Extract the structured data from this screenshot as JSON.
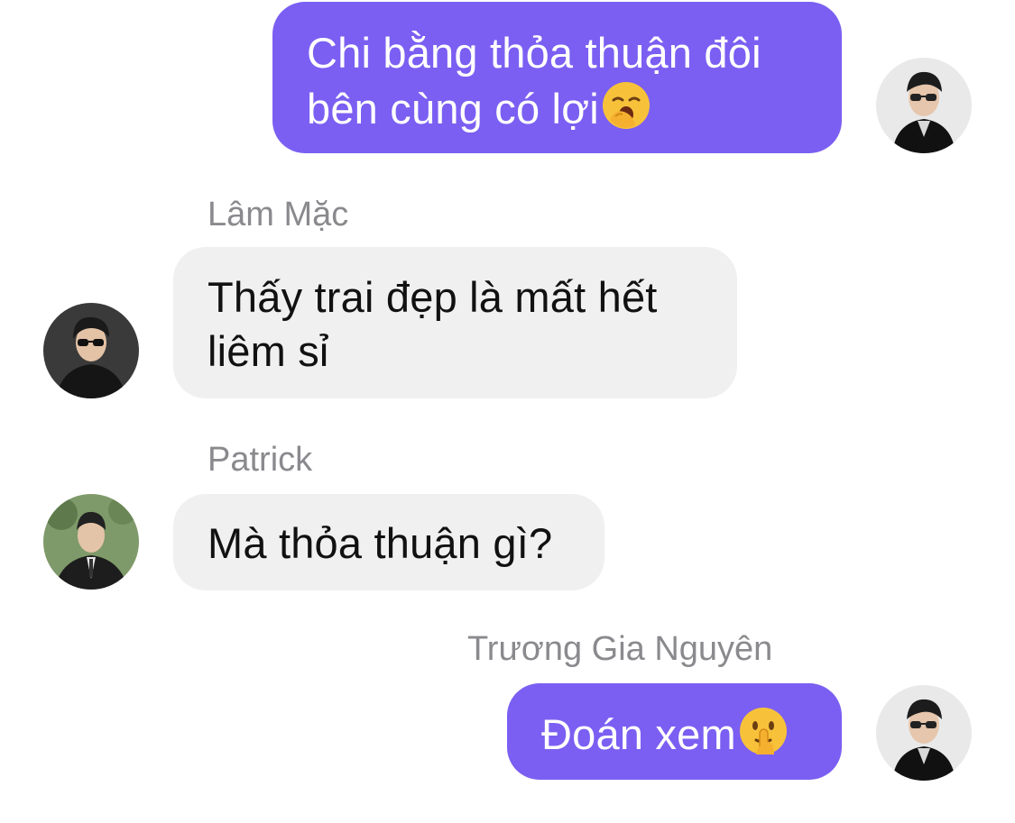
{
  "messages": [
    {
      "direction": "outgoing",
      "sender": "",
      "lines": [
        "Chi bằng thỏa thuận đôi",
        "bên cùng có lợi"
      ],
      "emoji": "yawning-face-icon"
    },
    {
      "direction": "incoming",
      "sender": "Lâm Mặc",
      "lines": [
        "Thấy trai đẹp là mất hết",
        "liêm sỉ"
      ],
      "emoji": ""
    },
    {
      "direction": "incoming",
      "sender": "Patrick",
      "lines": [
        "Mà thỏa thuận gì?"
      ],
      "emoji": ""
    },
    {
      "direction": "outgoing",
      "sender": "Trương Gia Nguyên",
      "lines": [
        "Đoán xem"
      ],
      "emoji": "shushing-face-icon"
    }
  ],
  "colors": {
    "outgoing_bubble": "#7b5ff2",
    "incoming_bubble": "#f0f0f0",
    "sender_name": "#8a8a8e"
  }
}
